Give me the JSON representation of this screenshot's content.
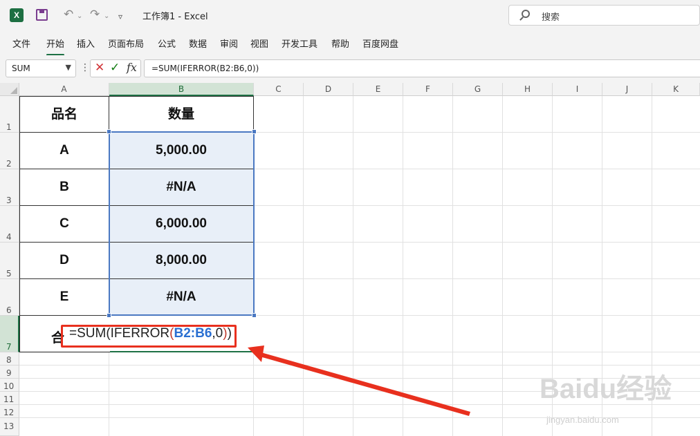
{
  "titlebar": {
    "app_icon_letter": "X",
    "title": "工作簿1  -  Excel",
    "search_placeholder": "搜索"
  },
  "menu": {
    "items": [
      "文件",
      "开始",
      "插入",
      "页面布局",
      "公式",
      "数据",
      "审阅",
      "视图",
      "开发工具",
      "帮助",
      "百度网盘"
    ],
    "active": "开始"
  },
  "formula_bar": {
    "name_box": "SUM",
    "vdots": "⋮",
    "formula": "=SUM(IFERROR(B2:B6,0))",
    "fx_label": "fx"
  },
  "sheet": {
    "columns": [
      "A",
      "B",
      "C",
      "D",
      "E",
      "F",
      "G",
      "H",
      "I",
      "J",
      "K"
    ],
    "selected_column": "B",
    "rows": [
      "1",
      "2",
      "3",
      "4",
      "5",
      "6",
      "7",
      "8",
      "9",
      "10",
      "11",
      "12",
      "13"
    ],
    "selected_row": "7",
    "header": {
      "a": "品名",
      "b": "数量"
    },
    "data": [
      {
        "a": "A",
        "b": "5,000.00"
      },
      {
        "a": "B",
        "b": "#N/A"
      },
      {
        "a": "C",
        "b": "6,000.00"
      },
      {
        "a": "D",
        "b": "8,000.00"
      },
      {
        "a": "E",
        "b": "#N/A"
      }
    ],
    "total_label": "合",
    "edit_formula": {
      "prefix": "=SUM(IFERROR",
      "open_paren": "(",
      "ref": "B2:B6",
      "suffix": ",0",
      "close_paren": ")",
      "end": ")"
    }
  },
  "colors": {
    "accent": "#1e7145",
    "selection": "#4a78c2",
    "annotation": "#e8301e"
  },
  "watermark": {
    "main": "Baidu经验",
    "sub": "jingyan.baidu.com"
  }
}
